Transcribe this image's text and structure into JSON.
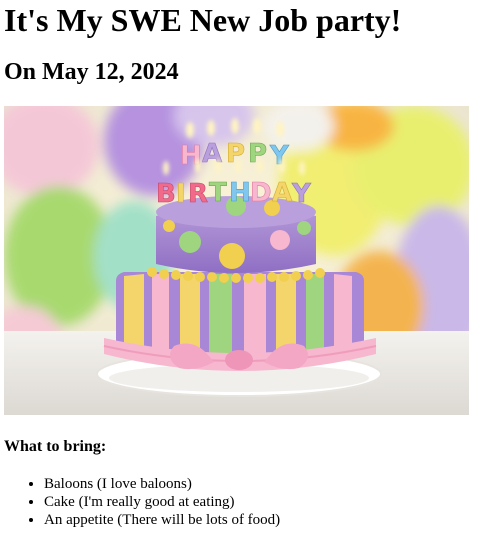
{
  "header": {
    "title": "It's My SWE New Job party!",
    "date_line": "On May 12, 2024"
  },
  "hero_image": {
    "icon": "birthday-cake-photo",
    "cake_text": "HAPPY BIRTHDAY"
  },
  "bring": {
    "title": "What to bring:",
    "items": [
      "Baloons (I love baloons)",
      "Cake (I'm really good at eating)",
      "An appetite (There will be lots of food)"
    ]
  }
}
